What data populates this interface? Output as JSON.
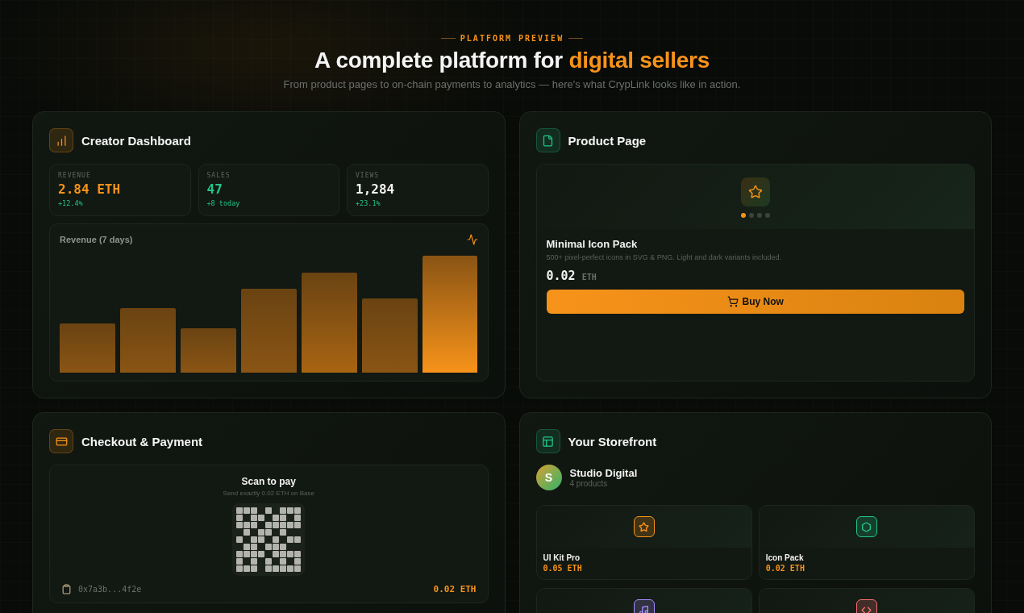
{
  "header": {
    "kicker": "PLATFORM PREVIEW",
    "title": "A complete platform for ",
    "title_accent": "digital sellers",
    "subtitle": "From product pages to on-chain payments to analytics — here's what CrypLink looks like in action."
  },
  "dashboard": {
    "title": "Creator Dashboard",
    "stats": [
      {
        "label": "REVENUE",
        "value": "2.84 ETH",
        "delta": "+12.4%",
        "color": "#f7931a"
      },
      {
        "label": "SALES",
        "value": "47",
        "delta": "+8 today",
        "color": "#22c58b"
      },
      {
        "label": "VIEWS",
        "value": "1,284",
        "delta": "+23.1%",
        "color": "#f2f2f2"
      }
    ],
    "chart_title": "Revenue (7 days)"
  },
  "product_page": {
    "title": "Product Page",
    "dots": [
      {
        "selected": true
      },
      {
        "selected": false
      },
      {
        "selected": false
      },
      {
        "selected": false
      }
    ],
    "name": "Minimal Icon Pack",
    "description": "500+ pixel-perfect icons in SVG & PNG. Light and dark variants included.",
    "price": "0.02",
    "currency": "ETH",
    "button": "Buy Now"
  },
  "checkout": {
    "title": "Checkout & Payment",
    "heading": "Scan to pay",
    "note": "Send exactly 0.02 ETH on Base",
    "address": "0x7a3b...4f2e",
    "amount": "0.02 ETH"
  },
  "storefront": {
    "title": "Your Storefront",
    "avatar": "S",
    "store_name": "Studio Digital",
    "count": "4 products",
    "products": [
      {
        "name": "UI Kit Pro",
        "price": "0.05 ETH",
        "color": "#f7931a"
      },
      {
        "name": "Icon Pack",
        "price": "0.02 ETH",
        "color": "#22c58b"
      },
      {
        "color": "#a78bfa"
      },
      {
        "color": "#f87171"
      }
    ]
  }
}
